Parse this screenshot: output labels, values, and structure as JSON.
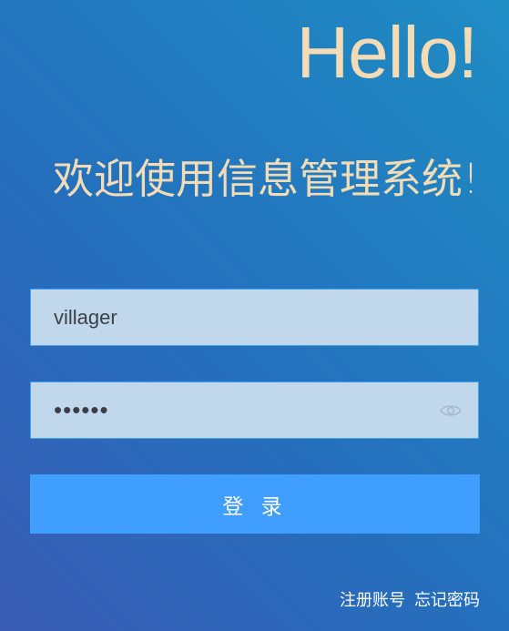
{
  "header": {
    "greeting": "Hello!",
    "welcome": "欢迎使用信息管理系统!"
  },
  "form": {
    "username_value": "villager",
    "password_value": "••••••",
    "password_toggle_icon": "eye-icon",
    "login_label": "登 录"
  },
  "footer": {
    "register_link": "注册账号",
    "forgot_link": "忘记密码"
  },
  "colors": {
    "accent": "#409eff",
    "heading": "#f3dcb5",
    "input_bg": "#c0d7ec",
    "input_border": "#3ea1f2"
  }
}
